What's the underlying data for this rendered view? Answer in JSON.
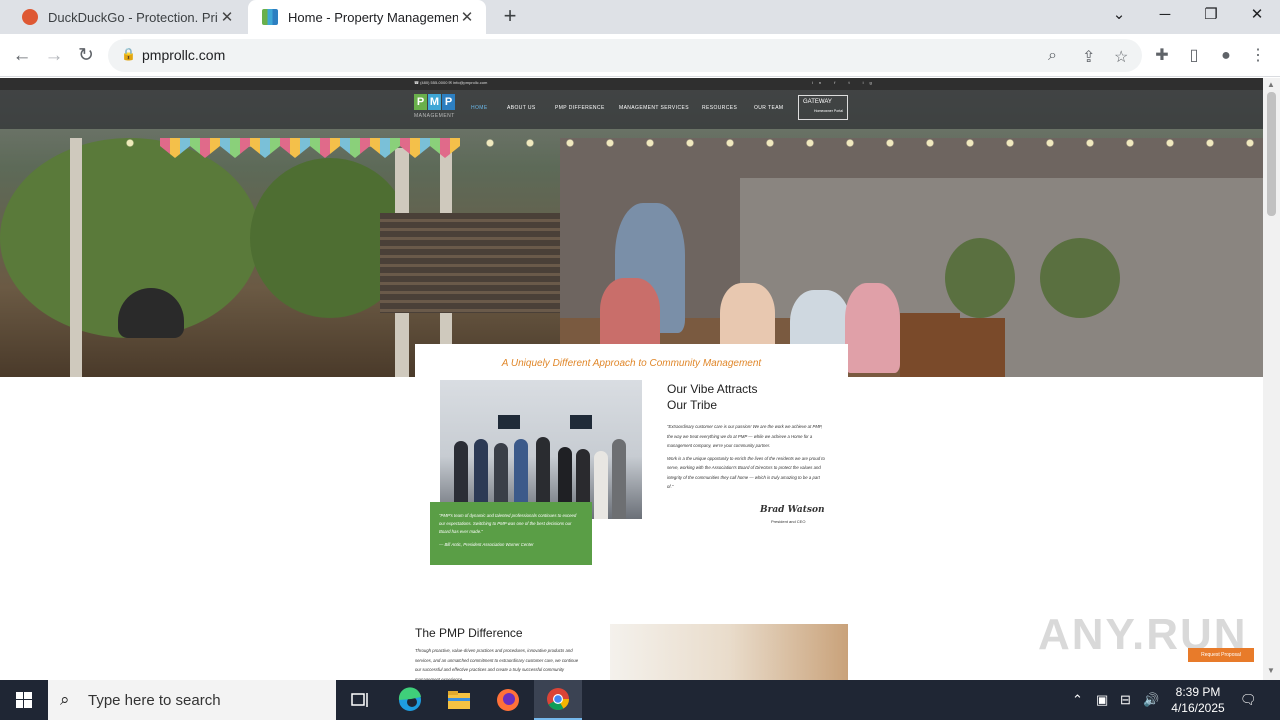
{
  "browser": {
    "tabs": [
      {
        "title": "DuckDuckGo - Protection. Privacy",
        "active": false
      },
      {
        "title": "Home - Property Management Pl",
        "active": true
      }
    ],
    "new_tab": "+",
    "url": "pmprollc.com",
    "window_controls": {
      "chevron": "⌄",
      "minimize": "─",
      "restore": "❐",
      "close": "✕"
    }
  },
  "site": {
    "topbar_contact": "☎ (480) 555-0000   ✉ info@pmprollc.com",
    "topbar_social": "in f t ig",
    "logo": {
      "letters": [
        "P",
        "M",
        "P"
      ],
      "colors": [
        "#6ab04c",
        "#3fa7d6",
        "#2d7fc1"
      ],
      "subtitle": "MANAGEMENT"
    },
    "nav": [
      {
        "label": "HOME",
        "active": true
      },
      {
        "label": "ABOUT US",
        "active": false
      },
      {
        "label": "PMP DIFFERENCE",
        "active": false
      },
      {
        "label": "MANAGEMENT SERVICES",
        "active": false
      },
      {
        "label": "RESOURCES",
        "active": false
      },
      {
        "label": "OUR TEAM",
        "active": false
      }
    ],
    "gateway": {
      "title": "GATEWAY",
      "subtitle": "Homeowner Portal"
    },
    "tagline": "A Uniquely Different Approach to Community Management",
    "vibe_line1": "Our Vibe Attracts",
    "vibe_line2": "Our Tribe",
    "body_p1": "\"Extraordinary customer care is our passion! We are the work we achieve at PMP, the way we treat everything we do at PMP — while we achieve a Home for a management company, we're your community partner.",
    "body_p2": "Work is a the unique opportunity to enrich the lives of the residents we are proud to serve, working with the Association's Board of Directors to protect the values and integrity of the communities they call home — which is truly amazing to be a part of.\"",
    "signature": "Brad Watson",
    "signature_title": "President and CEO",
    "quote": "\"PMP's team of dynamic and talented professionals continues to exceed our expectations. Switching to PMP was one of the best decisions our Board has ever made.\"",
    "quote_author": "— Bill Antic, President Association Warner Center",
    "difference_title": "The PMP Difference",
    "difference_text": "Through proactive, value-driven practices and procedures, innovative products and services, and an unmatched commitment to extraordinary customer care, we continue our successful and effective practices and create a truly successful community management experience.",
    "request_button": "Request Proposal"
  },
  "watermark": "ANY.RUN",
  "taskbar": {
    "search_placeholder": "Type here to search",
    "time": "8:39 PM",
    "date": "4/16/2025"
  }
}
